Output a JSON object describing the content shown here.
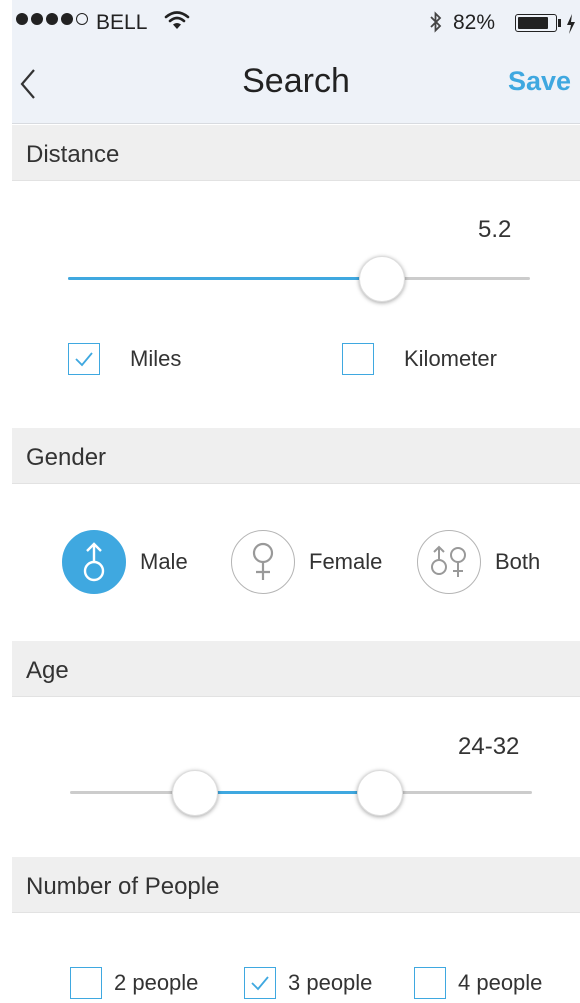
{
  "status_bar": {
    "carrier": "BELL",
    "battery_percent": "82%",
    "battery_level": 0.82
  },
  "nav": {
    "title": "Search",
    "save_label": "Save"
  },
  "distance": {
    "header": "Distance",
    "value": "5.2",
    "slider_fraction": 0.68,
    "units": [
      {
        "label": "Miles",
        "checked": true
      },
      {
        "label": "Kilometer",
        "checked": false
      }
    ]
  },
  "gender": {
    "header": "Gender",
    "options": [
      {
        "label": "Male",
        "selected": true
      },
      {
        "label": "Female",
        "selected": false
      },
      {
        "label": "Both",
        "selected": false
      }
    ]
  },
  "age": {
    "header": "Age",
    "value": "24-32",
    "range_fraction": [
      0.27,
      0.67
    ]
  },
  "people": {
    "header": "Number of People",
    "options": [
      {
        "label": "2 people",
        "checked": false
      },
      {
        "label": "3 people",
        "checked": true
      },
      {
        "label": "4 people",
        "checked": false
      }
    ]
  },
  "colors": {
    "accent": "#3fa8e0",
    "header_bg": "#efefef",
    "nav_bg": "#eef2f8"
  }
}
